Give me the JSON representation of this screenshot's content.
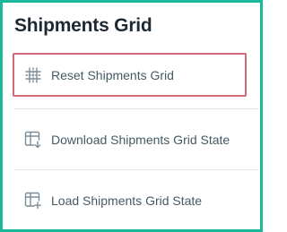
{
  "panel": {
    "title": "Shipments Grid"
  },
  "menu": {
    "items": [
      {
        "label": "Reset Shipments Grid",
        "icon": "reset-grid-icon",
        "highlighted": true
      },
      {
        "label": "Download Shipments Grid State",
        "icon": "grid-download-icon",
        "highlighted": false
      },
      {
        "label": "Load Shipments Grid State",
        "icon": "grid-add-icon",
        "highlighted": false
      }
    ]
  },
  "colors": {
    "frame_border": "#1cb89b",
    "highlight_border": "#d36a78",
    "text": "#455a64",
    "icon": "#7b8d99",
    "title": "#1f2933"
  }
}
